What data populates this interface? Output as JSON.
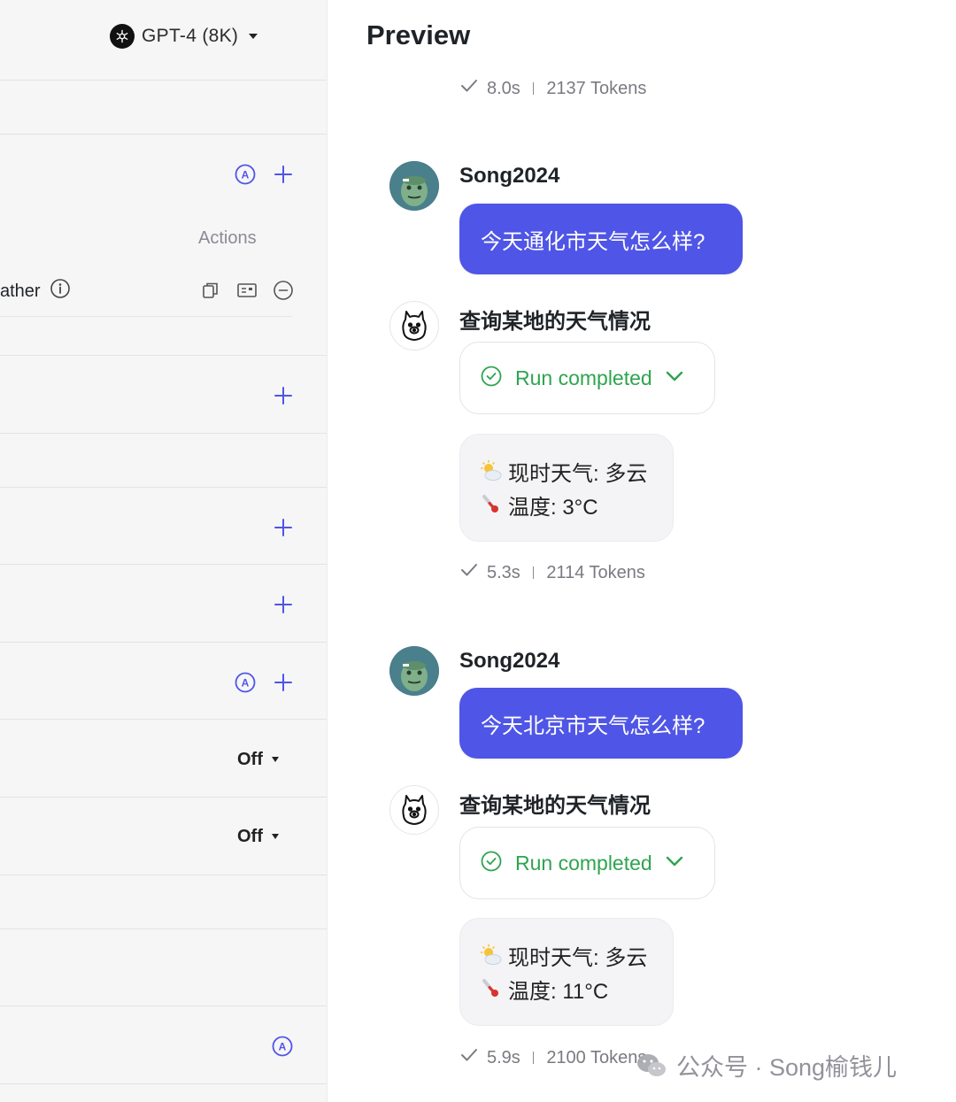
{
  "config": {
    "model": {
      "label": "GPT-4 (8K)",
      "icon": "openai-logo-icon"
    },
    "actions_header": "Actions",
    "plugin": {
      "name": "ather"
    },
    "toggles": [
      {
        "value": "Off"
      },
      {
        "value": "Off"
      }
    ]
  },
  "preview": {
    "title": "Preview",
    "first_meta": {
      "time": "8.0s",
      "tokens": "2137 Tokens"
    },
    "conversations": [
      {
        "user": "Song2024",
        "message": "今天通化市天气怎么样?",
        "tool": "查询某地的天气情况",
        "run_status": "Run completed",
        "result": {
          "weather": "现时天气: 多云",
          "temperature": "温度: 3°C"
        },
        "meta": {
          "time": "5.3s",
          "tokens": "2114 Tokens"
        }
      },
      {
        "user": "Song2024",
        "message": "今天北京市天气怎么样?",
        "tool": "查询某地的天气情况",
        "run_status": "Run completed",
        "result": {
          "weather": "现时天气: 多云",
          "temperature": "温度: 11°C"
        },
        "meta": {
          "time": "5.9s",
          "tokens": "2100 Tokens"
        }
      }
    ]
  },
  "watermark": "公众号 · Song榆钱儿",
  "colors": {
    "accent": "#4f55e6",
    "success": "#2ea44f",
    "panel_bg": "#f6f6f7"
  }
}
